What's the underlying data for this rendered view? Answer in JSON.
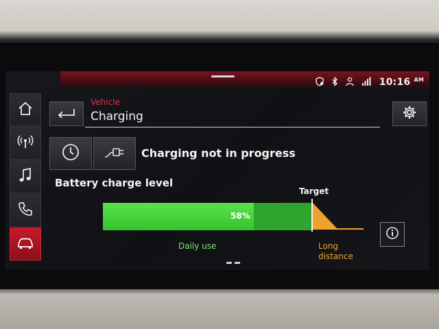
{
  "status": {
    "time": "10:16",
    "ampm": "AM",
    "icons": [
      "connect-shield-icon",
      "bluetooth-icon",
      "user-icon",
      "lte-signal-icon"
    ]
  },
  "sidebar": {
    "items": [
      {
        "name": "home-icon"
      },
      {
        "name": "radio-icon"
      },
      {
        "name": "music-icon"
      },
      {
        "name": "phone-icon"
      },
      {
        "name": "car-icon",
        "active": true
      }
    ]
  },
  "header": {
    "breadcrumb": "Vehicle",
    "title": "Charging"
  },
  "charging": {
    "status_text": "Charging not in progress",
    "section_label": "Battery charge level",
    "level_percent": 58,
    "level_label": "58%",
    "target_label": "Target",
    "daily_label": "Daily use",
    "long_label_line1": "Long",
    "long_label_line2": "distance"
  },
  "colors": {
    "accent_red": "#c41a2a",
    "green": "#35c22f",
    "orange": "#f0a12e"
  }
}
